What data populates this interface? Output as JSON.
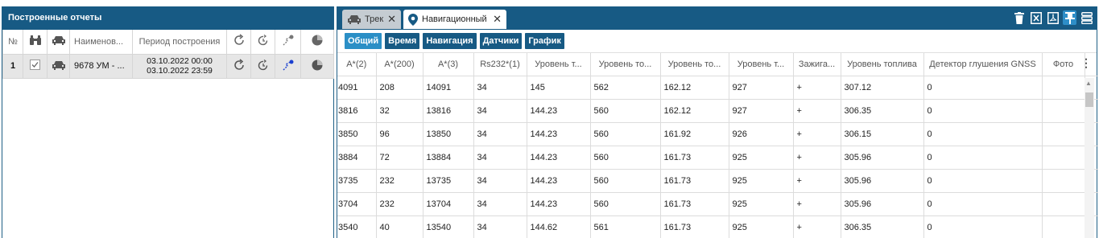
{
  "left_panel": {
    "title": "Построенные отчеты",
    "headers": {
      "num": "№",
      "name": "Наименов...",
      "period": "Период построения"
    },
    "row": {
      "num": "1",
      "name": "9678 УМ - ...",
      "period_start": "03.10.2022 00:00",
      "period_end": "03.10.2022 23:59"
    }
  },
  "tabs": [
    {
      "label": "Трек",
      "icon": "car-icon"
    },
    {
      "label": "Навигационный",
      "icon": "location-pin-icon"
    }
  ],
  "toolbar_icons": [
    "trash-icon",
    "excel-icon",
    "pdf-icon",
    "pin-icon",
    "layout-icon"
  ],
  "filter_buttons": [
    {
      "label": "Общий",
      "active": true
    },
    {
      "label": "Время",
      "active": false
    },
    {
      "label": "Навигация",
      "active": false
    },
    {
      "label": "Датчики",
      "active": false
    },
    {
      "label": "График",
      "active": false
    }
  ],
  "columns": [
    "A*(2)",
    "A*(200)",
    "A*(3)",
    "Rs232*(1)",
    "Уровень т...",
    "Уровень то...",
    "Уровень то...",
    "Уровень т...",
    "Зажига...",
    "Уровень топлива",
    "Детектор глушения GNSS",
    "Фото"
  ],
  "rows": [
    [
      "4091",
      "208",
      "14091",
      "34",
      "145",
      "562",
      "162.12",
      "927",
      "+",
      "307.12",
      "0",
      ""
    ],
    [
      "3816",
      "32",
      "13816",
      "34",
      "144.23",
      "560",
      "162.12",
      "927",
      "+",
      "306.35",
      "0",
      ""
    ],
    [
      "3850",
      "96",
      "13850",
      "34",
      "144.23",
      "560",
      "161.92",
      "926",
      "+",
      "306.15",
      "0",
      ""
    ],
    [
      "3884",
      "72",
      "13884",
      "34",
      "144.23",
      "560",
      "161.73",
      "925",
      "+",
      "305.96",
      "0",
      ""
    ],
    [
      "3735",
      "232",
      "13735",
      "34",
      "144.23",
      "560",
      "161.73",
      "925",
      "+",
      "305.96",
      "0",
      ""
    ],
    [
      "3704",
      "232",
      "13704",
      "34",
      "144.23",
      "560",
      "161.73",
      "925",
      "+",
      "305.96",
      "0",
      ""
    ],
    [
      "3540",
      "40",
      "13540",
      "34",
      "144.62",
      "561",
      "161.73",
      "925",
      "+",
      "306.35",
      "0",
      ""
    ]
  ],
  "colors": {
    "header_bg": "#175a84",
    "active_button": "#2b8fc6",
    "selected_row": "#e6e6e6"
  }
}
